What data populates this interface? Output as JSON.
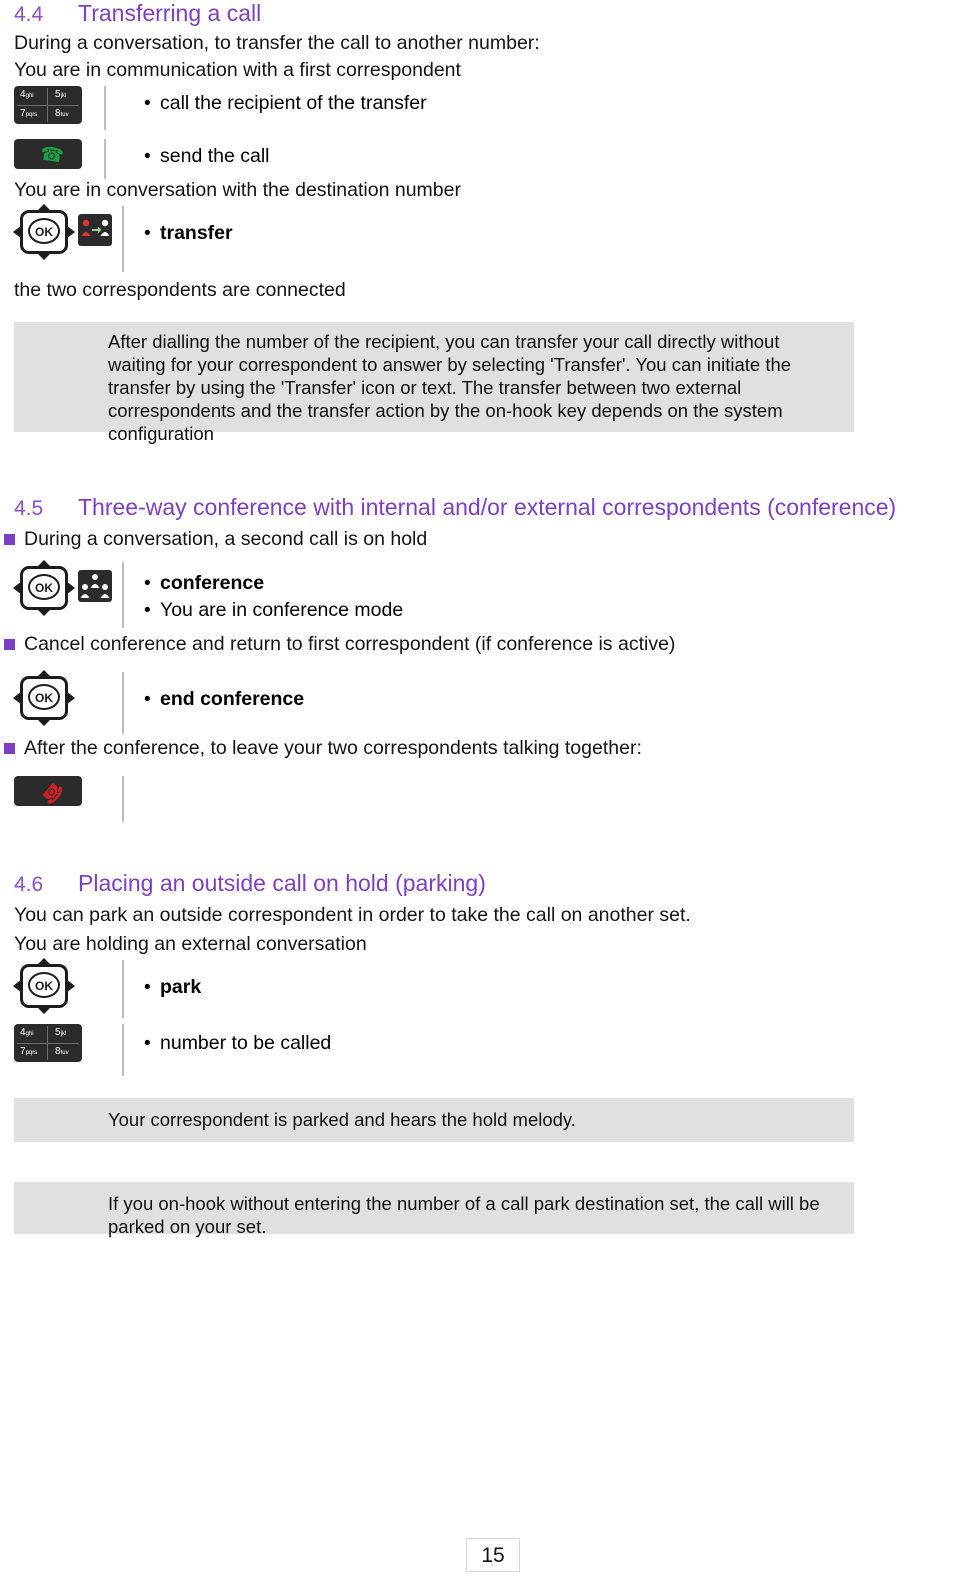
{
  "document": {
    "page_number": "15"
  },
  "sections": [
    {
      "number": "4.4",
      "title": "Transferring a call",
      "intro1": "During a conversation, to transfer the call to another number:",
      "intro2": "You are in communication with a first correspondent",
      "steps": [
        {
          "icon": "keypad-icon",
          "label": "call the recipient of the transfer",
          "bold": false
        },
        {
          "icon": "offhook-handset-icon",
          "label": "send the call",
          "bold": false
        }
      ],
      "mid_text": "You are in conversation with the destination number",
      "steps2": [
        {
          "icon": "navigator-ok-icon+transfer-glyph-icon",
          "label": "transfer",
          "bold": true
        }
      ],
      "after_text": "the two correspondents are connected",
      "note": "After dialling the number of the recipient, you can transfer your call directly without waiting for your correspondent to answer by selecting 'Transfer'. You can initiate the transfer by using the 'Transfer' icon or text. The transfer between two external correspondents and the transfer action by the on-hook key depends on the system configuration"
    },
    {
      "number": "4.5",
      "title": "Three-way conference with internal and/or external correspondents (conference)",
      "bullets": [
        "During a conversation, a second call is on hold",
        "Cancel conference and return to first correspondent (if conference is active)",
        "After the conference, to leave your two correspondents talking together:"
      ],
      "steps": [
        {
          "icon": "navigator-ok-icon+conference-glyph-icon",
          "label": "conference",
          "bold": true,
          "label2": "You are in conference mode"
        },
        {
          "icon": "navigator-ok-icon",
          "label": "end conference",
          "bold": true
        },
        {
          "icon": "onhook-handset-icon",
          "label": "",
          "bold": false
        }
      ]
    },
    {
      "number": "4.6",
      "title": "Placing an outside call on hold (parking)",
      "intro1": "You can park an outside correspondent in order to take the call on another set.",
      "intro2": "You are holding an external conversation",
      "steps": [
        {
          "icon": "navigator-ok-icon",
          "label": "park",
          "bold": true
        },
        {
          "icon": "keypad-icon",
          "label": "number to be called",
          "bold": false
        }
      ],
      "notes": [
        "Your correspondent is parked and hears the hold melody.",
        "If you on-hook without entering the number of a call park destination set, the call will be parked on your set."
      ]
    }
  ],
  "keypad": {
    "keys": [
      {
        "digit": "4",
        "sub": "ghi"
      },
      {
        "digit": "5",
        "sub": "jkl"
      },
      {
        "digit": "7",
        "sub": "pqrs"
      },
      {
        "digit": "8",
        "sub": "tuv"
      }
    ]
  },
  "navigator": {
    "ok_label": "OK"
  },
  "colors": {
    "heading": "#7d3fc4",
    "note_background": "#e0e0e0",
    "bullet_square": "#7d3fc4",
    "offhook_green": "#19a347",
    "onhook_red": "#d12026"
  }
}
